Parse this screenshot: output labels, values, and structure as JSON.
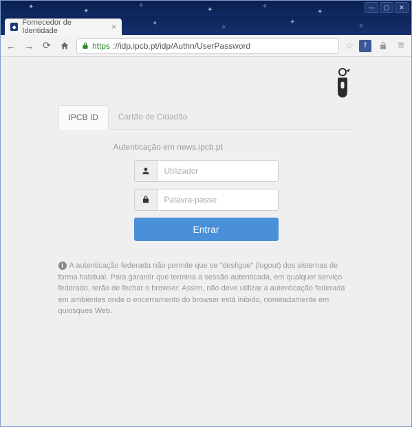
{
  "window": {
    "min": "—",
    "max": "▢",
    "close": "✕"
  },
  "browser": {
    "tab_title": "Fornecedor de Identidade",
    "url_scheme": "https",
    "url_rest": "://idp.ipcb.pt/idp/Authn/UserPassword"
  },
  "page": {
    "tabs": [
      {
        "label": "IPCB ID",
        "active": true
      },
      {
        "label": "Cartão de Cidadão",
        "active": false
      }
    ],
    "auth_message": "Autenticação em news.ipcb.pt",
    "username_placeholder": "Utilizador",
    "password_placeholder": "Palavra-passe",
    "submit_label": "Entrar",
    "notice": "A autenticação federada não permite que se \"desligue\" (logout) dos sistemas de forma habitual. Para garantir que termina a sessão autenticada, em qualquer serviço federado, terão de fechar o browser. Assim, não deve utilizar a autenticação federada em ambientes onde o encerramento do browser está inibido, nomeadamente em quiosques Web."
  }
}
